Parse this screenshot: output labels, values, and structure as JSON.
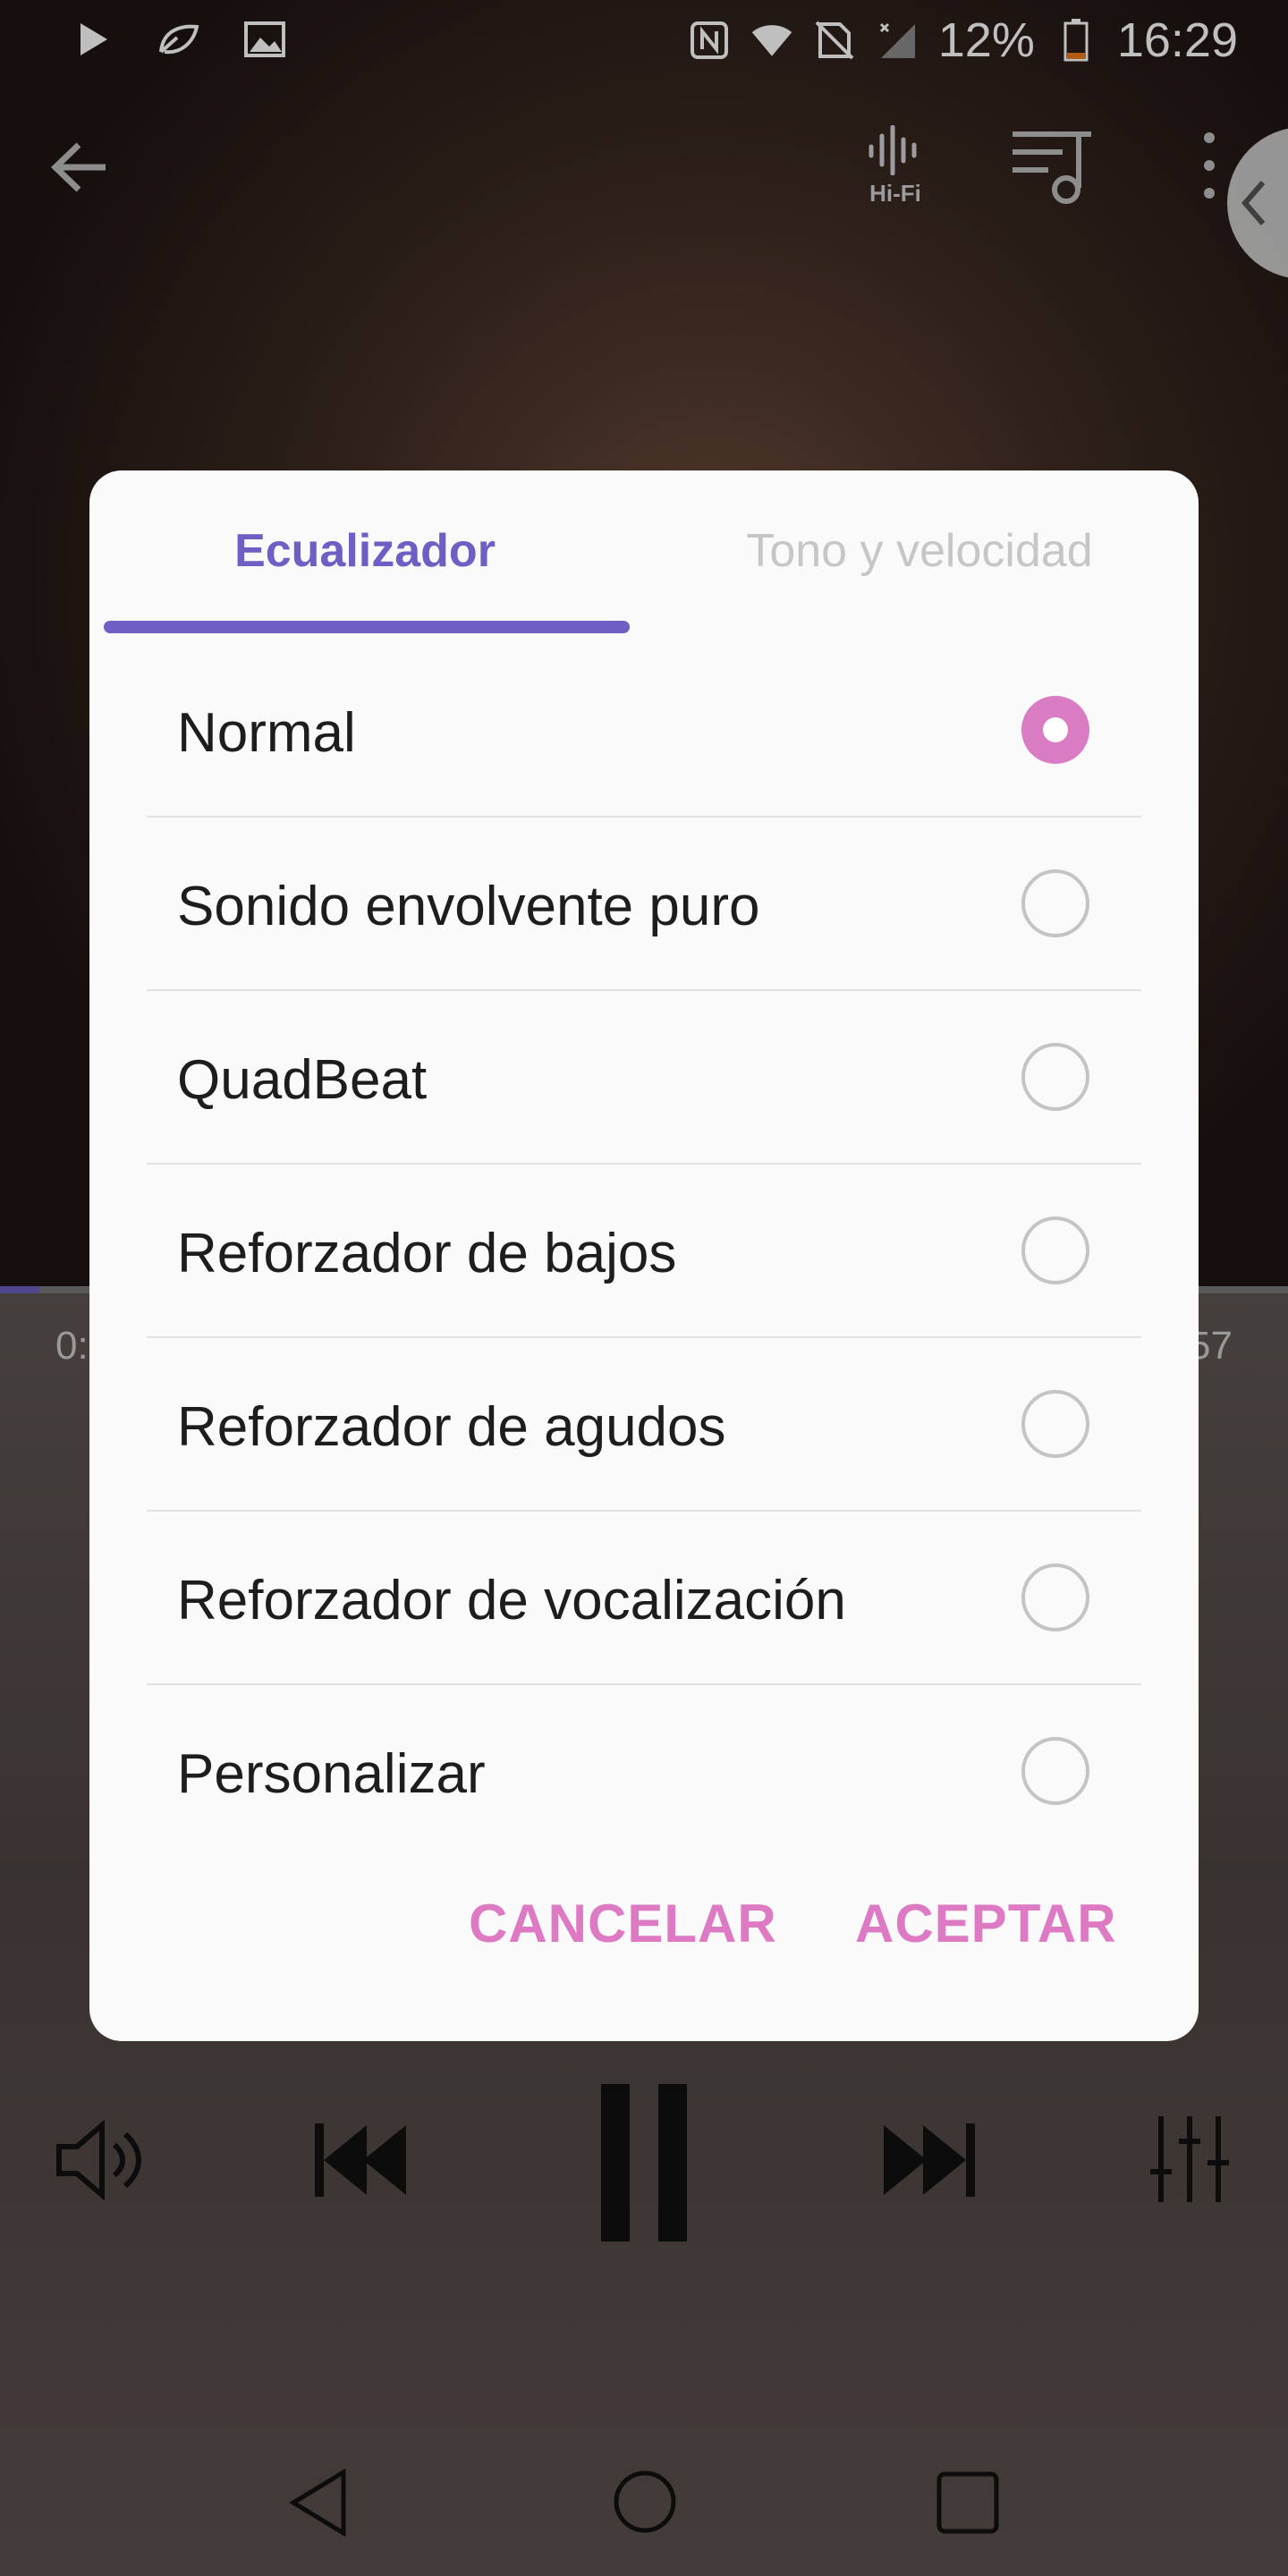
{
  "status_bar": {
    "battery_percent": "12%",
    "time": "16:29",
    "icons": [
      "play-icon",
      "leaf-icon",
      "image-icon",
      "nfc-icon",
      "wifi-icon",
      "no-sim-icon",
      "signal-icon",
      "battery-icon"
    ]
  },
  "app_bar": {
    "hifi_label": "Hi-Fi",
    "icons": [
      "back-arrow-icon",
      "hifi-icon",
      "playlist-icon",
      "more-vert-icon",
      "chevron-left-icon"
    ]
  },
  "player": {
    "time_elapsed": "0:",
    "time_total": "57",
    "progress_fraction": 0.03
  },
  "dialog": {
    "tabs": [
      {
        "label": "Ecualizador",
        "active": true
      },
      {
        "label": "Tono y velocidad",
        "active": false
      }
    ],
    "options": [
      {
        "label": "Normal",
        "selected": true
      },
      {
        "label": "Sonido envolvente puro",
        "selected": false
      },
      {
        "label": "QuadBeat",
        "selected": false
      },
      {
        "label": "Reforzador de bajos",
        "selected": false
      },
      {
        "label": "Reforzador de agudos",
        "selected": false
      },
      {
        "label": "Reforzador de vocalización",
        "selected": false
      },
      {
        "label": "Personalizar",
        "selected": false
      }
    ],
    "cancel_label": "CANCELAR",
    "accept_label": "ACEPTAR"
  },
  "colors": {
    "accent_purple": "#6f5fc4",
    "accent_pink": "#de7ac3",
    "radio_selected": "#d97cc4"
  }
}
